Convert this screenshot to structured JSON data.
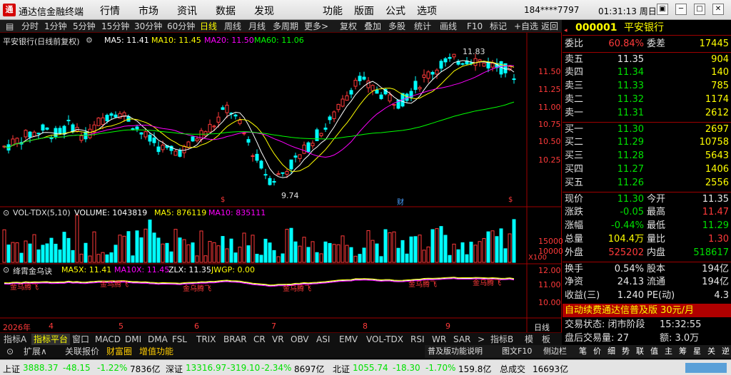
{
  "titlebar": {
    "logo": "通",
    "app_title": "通达信金融终端",
    "menus": [
      "行情",
      "市场",
      "资讯",
      "数据",
      "发现",
      "功能",
      "版面",
      "公式",
      "选项"
    ],
    "user": "184****7797",
    "time": "01:31:13 周日"
  },
  "toolbar": {
    "items": [
      "分时",
      "1分钟",
      "5分钟",
      "15分钟",
      "30分钟",
      "60分钟",
      "日线",
      "周线",
      "月线",
      "多周期",
      "更多>",
      "复权",
      "叠加",
      "多股",
      "统计",
      "画线",
      "F10",
      "标记",
      "+自选",
      "返回"
    ],
    "active": "日线"
  },
  "kline": {
    "header": "平安银行(日线前复权)",
    "ma5": "MA5: 11.41",
    "ma10": "MA10: 11.45",
    "ma20": "MA20: 11.50",
    "ma60": "MA60: 11.06",
    "price_ticks": [
      "11.50",
      "11.25",
      "11.00",
      "10.75",
      "10.50",
      "10.25"
    ],
    "high_label": "11.83",
    "low_label": "9.74",
    "event_markers": [
      "$",
      "财",
      "$"
    ]
  },
  "volume": {
    "header": "VOL-TDX(5,10)",
    "vol": "VOLUME: 1043819",
    "ma5": "MA5: 876119",
    "ma10": "MA10: 835111",
    "ticks": [
      "15000",
      "10000",
      "5000"
    ],
    "unit": "X100"
  },
  "indicator": {
    "header": "绛霄金乌诀",
    "ma5x": "MA5X: 11.41",
    "ma10x": "MA10X: 11.45",
    "zlx": "ZLX: 11.35",
    "jwgp": "JWGP: 0.00",
    "ticks": [
      "12.00",
      "11.00",
      "10.00"
    ],
    "signals": [
      "金乌腾飞",
      "金乌腾飞",
      "金乌腾飞",
      "金乌腾飞",
      "金乌腾飞",
      "金乌腾飞"
    ]
  },
  "xaxis": {
    "labels": [
      "2026年",
      "4",
      "5",
      "6",
      "7",
      "8",
      "9"
    ],
    "period": "日线"
  },
  "quote": {
    "code": "000001",
    "name": "平安银行",
    "weibi_label": "委比",
    "weibi": "60.84%",
    "weicha_label": "委差",
    "weicha": "17445",
    "sell": [
      {
        "label": "卖五",
        "price": "11.35",
        "vol": "904"
      },
      {
        "label": "卖四",
        "price": "11.34",
        "vol": "140"
      },
      {
        "label": "卖三",
        "price": "11.33",
        "vol": "785"
      },
      {
        "label": "卖二",
        "price": "11.32",
        "vol": "1174"
      },
      {
        "label": "卖一",
        "price": "11.31",
        "vol": "2612"
      }
    ],
    "buy": [
      {
        "label": "买一",
        "price": "11.30",
        "vol": "2697"
      },
      {
        "label": "买二",
        "price": "11.29",
        "vol": "10758"
      },
      {
        "label": "买三",
        "price": "11.28",
        "vol": "5643"
      },
      {
        "label": "买四",
        "price": "11.27",
        "vol": "1406"
      },
      {
        "label": "买五",
        "price": "11.26",
        "vol": "2556"
      }
    ],
    "stats": [
      {
        "l1": "现价",
        "v1": "11.30",
        "l2": "今开",
        "v2": "11.35"
      },
      {
        "l1": "涨跌",
        "v1": "-0.05",
        "l2": "最高",
        "v2": "11.47"
      },
      {
        "l1": "涨幅",
        "v1": "-0.44%",
        "l2": "最低",
        "v2": "11.29"
      },
      {
        "l1": "总量",
        "v1": "104.4万",
        "l2": "量比",
        "v2": "1.30"
      },
      {
        "l1": "外盘",
        "v1": "525202",
        "l2": "内盘",
        "v2": "518617"
      }
    ],
    "stats2": [
      {
        "l1": "换手",
        "v1": "0.54%",
        "l2": "股本",
        "v2": "194亿"
      },
      {
        "l1": "净资",
        "v1": "24.13",
        "l2": "流通",
        "v2": "194亿"
      },
      {
        "l1": "收益(三)",
        "v1": "1.240",
        "l2": "PE(动)",
        "v2": "4.3"
      }
    ],
    "ad": "自动续费通达信普及版 30元/月",
    "trade_status": "交易状态: 闭市阶段",
    "trade_time": "15:32:55",
    "after_vol": "盘后交易量: 27",
    "after_amt": "额: 3.0万"
  },
  "tabs_row1": [
    "指标A",
    "指标平台",
    "窗口",
    "MACD",
    "DMI",
    "DMA",
    "FSL",
    "TRIX",
    "BRAR",
    "CR",
    "VR",
    "OBV",
    "ASI",
    "EMV",
    "VOL-TDX",
    "RSI",
    "WR",
    "SAR",
    ">",
    "指标B",
    "模",
    "板"
  ],
  "tabs_row2": [
    "扩展∧",
    "关联报价",
    "财富圈",
    "增值功能"
  ],
  "rp_bottom": [
    "普及版功能说明",
    "图文F10",
    "侧边栏",
    "笔",
    "价",
    "细",
    "势",
    "联",
    "值",
    "主",
    "筹",
    "星",
    "关",
    "逆",
    "五"
  ],
  "statusbar": {
    "sh_label": "上证",
    "sh_val": "3888.37",
    "sh_chg": "-48.15",
    "sh_pct": "-1.22%",
    "sh_amt": "7836亿",
    "sz_label": "深证",
    "sz_val": "13316.97",
    "sz_chg": "-319.10",
    "sz_pct": "-2.34%",
    "sz_amt": "8697亿",
    "bz_label": "北证",
    "bz_val": "1055.74",
    "bz_chg": "-18.30",
    "bz_pct": "-1.70%",
    "bz_amt": "159.8亿",
    "total_label": "总成交",
    "total": "16693亿"
  }
}
